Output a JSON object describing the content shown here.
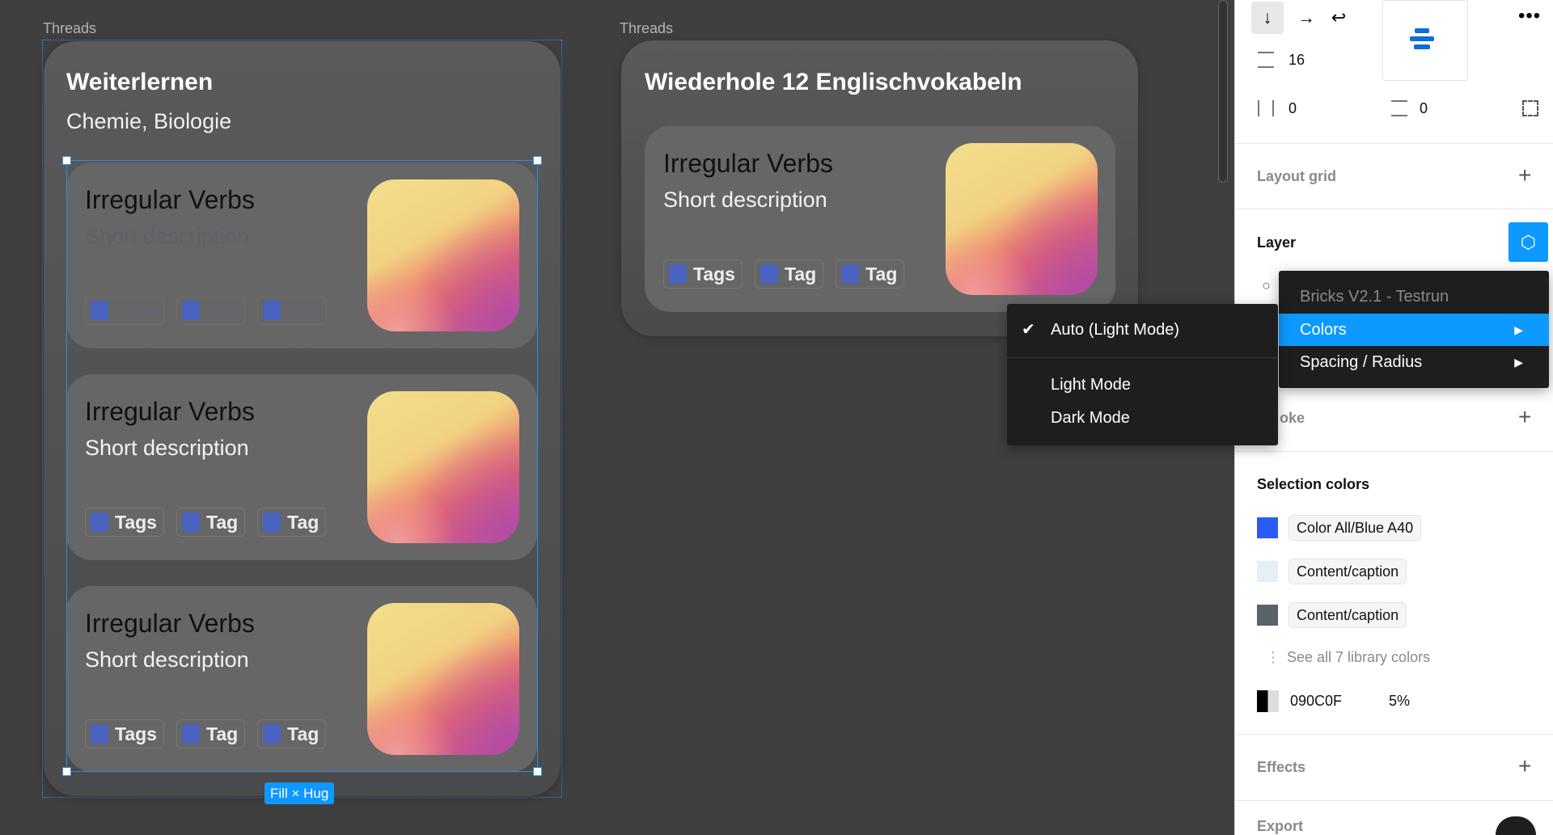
{
  "canvas": {
    "frame_left": {
      "label": "Threads",
      "title": "Weiterlernen",
      "subtitle": "Chemie, Biologie",
      "size_badge": "Fill × Hug",
      "cards": [
        {
          "title": "Irregular Verbs",
          "description": "Short description",
          "tags": [
            "Tags",
            "Tag",
            "Tag"
          ],
          "dimmed": true
        },
        {
          "title": "Irregular Verbs",
          "description": "Short description",
          "tags": [
            "Tags",
            "Tag",
            "Tag"
          ],
          "dimmed": false
        },
        {
          "title": "Irregular Verbs",
          "description": "Short description",
          "tags": [
            "Tags",
            "Tag",
            "Tag"
          ],
          "dimmed": false
        }
      ]
    },
    "frame_right": {
      "label": "Threads",
      "title": "Wiederhole 12 Englischvokabeln",
      "cards": [
        {
          "title": "Irregular Verbs",
          "description": "Short description",
          "tags": [
            "Tags",
            "Tag",
            "Tag"
          ],
          "dimmed": false
        }
      ]
    }
  },
  "panel": {
    "auto_layout": {
      "direction_icons": [
        "arrow-down-icon",
        "arrow-right-icon",
        "wrap-icon"
      ],
      "gap": "16",
      "padding_h": "0",
      "padding_v": "0"
    },
    "layout_grid": "Layout grid",
    "layer": "Layer",
    "stroke_partial": "oke",
    "selection_colors": {
      "title": "Selection colors",
      "items": [
        {
          "name": "Color All/Blue A40",
          "color": "#2a5cf5"
        },
        {
          "name": "Content/caption",
          "color": "#e6eef7"
        },
        {
          "name": "Content/caption",
          "color": "#5b636a"
        }
      ],
      "see_all": "See all 7 library colors",
      "hex": "090C0F",
      "opacity": "5%"
    },
    "effects": "Effects",
    "export": "Export"
  },
  "library_menu": {
    "header": "Bricks V2.1 - Testrun",
    "items": [
      {
        "label": "Colors",
        "active": true
      },
      {
        "label": "Spacing / Radius",
        "active": false
      }
    ]
  },
  "mode_menu": {
    "items": [
      {
        "label": "Auto (Light Mode)",
        "checked": true
      },
      {
        "label": "Light Mode",
        "checked": false
      },
      {
        "label": "Dark Mode",
        "checked": false
      }
    ]
  },
  "colors": {
    "accent": "#0d99ff",
    "selection": "#2d8ee6",
    "tag_square": "#4a63c0"
  }
}
